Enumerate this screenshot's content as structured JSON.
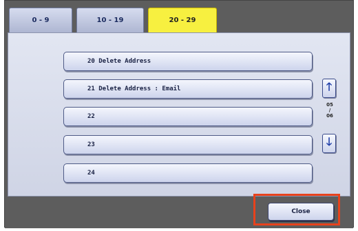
{
  "tabs": [
    {
      "label": "0 - 9",
      "active": false
    },
    {
      "label": "10 - 19",
      "active": false
    },
    {
      "label": "20 - 29",
      "active": true
    }
  ],
  "rows": [
    {
      "label": "20  Delete Address"
    },
    {
      "label": "21  Delete Address : Email"
    },
    {
      "label": "22"
    },
    {
      "label": "23"
    },
    {
      "label": "24"
    }
  ],
  "pager": {
    "current": "05",
    "separator": "/",
    "total": "06",
    "up_icon": "arrow-up-icon",
    "down_icon": "arrow-down-icon"
  },
  "footer": {
    "close_label": "Close"
  },
  "colors": {
    "active_tab": "#f7f040",
    "highlight": "#e8421c",
    "arrow": "#1f3ea8"
  }
}
